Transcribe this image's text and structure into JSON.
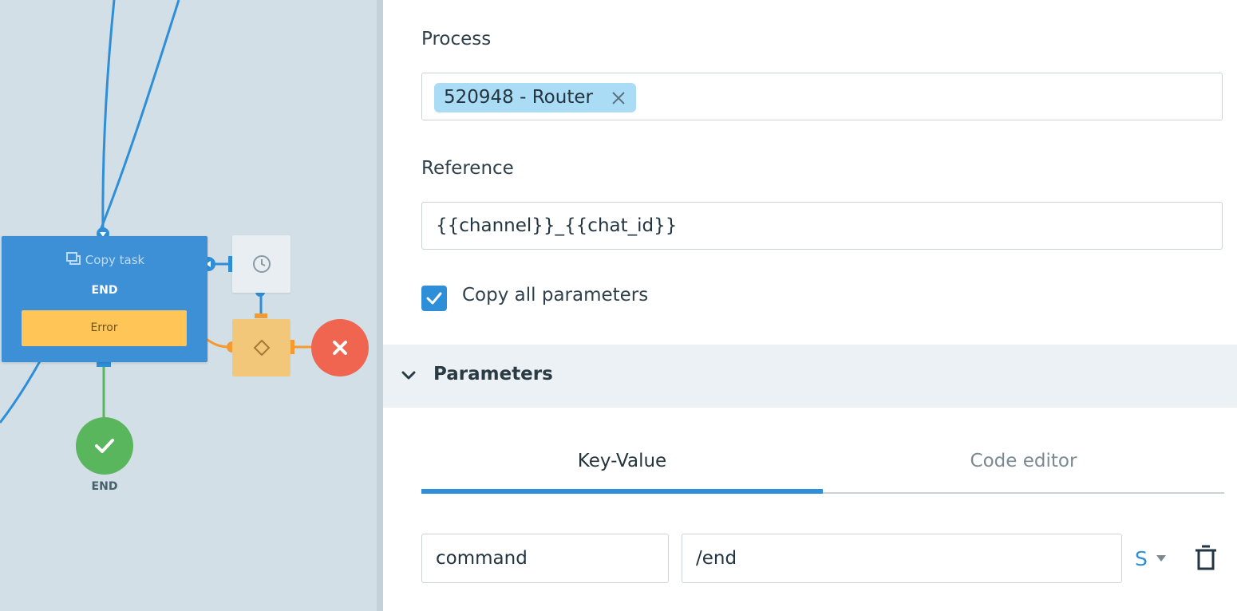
{
  "canvas": {
    "task_node": {
      "title": "Copy task",
      "subtitle": "END",
      "error_label": "Error"
    },
    "end_node": {
      "label": "END"
    }
  },
  "panel": {
    "process": {
      "label": "Process",
      "tag": "520948 - Router"
    },
    "reference": {
      "label": "Reference",
      "value": "{{channel}}_{{chat_id}}"
    },
    "copy_all": {
      "label": "Copy all parameters",
      "checked": true
    },
    "parameters": {
      "title": "Parameters",
      "tabs": [
        {
          "label": "Key-Value",
          "active": true
        },
        {
          "label": "Code editor",
          "active": false
        }
      ],
      "rows": [
        {
          "key": "command",
          "value": "/end",
          "type": "S"
        }
      ]
    }
  },
  "colors": {
    "accent": "#2f8ed8",
    "task_node": "#3d8fd6",
    "error": "#ffc556",
    "success": "#5ab65c",
    "danger": "#f0654f",
    "tag_bg": "#abdcf5"
  }
}
